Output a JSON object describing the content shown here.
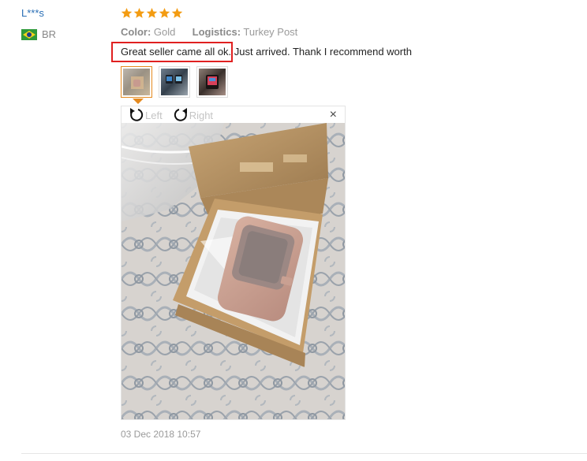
{
  "reviewer": {
    "name": "L***s",
    "country_code": "BR"
  },
  "review": {
    "rating": 5,
    "color_label": "Color:",
    "color_value": "Gold",
    "logistics_label": "Logistics:",
    "logistics_value": "Turkey Post",
    "text": "Great seller came all ok. Just arrived. Thank I recommend worth",
    "timestamp": "03 Dec 2018 10:57"
  },
  "viewer": {
    "rotate_left_label": "Left",
    "rotate_right_label": "Right",
    "close_label": "×"
  },
  "icons": {
    "star": "star-icon",
    "rotate_left": "rotate-left-icon",
    "rotate_right": "rotate-right-icon",
    "close": "close-icon",
    "flag": "brazil-flag-icon"
  },
  "colors": {
    "accent_orange": "#e58a1f",
    "highlight_red": "#e02020",
    "link_blue": "#2a6fb5"
  }
}
